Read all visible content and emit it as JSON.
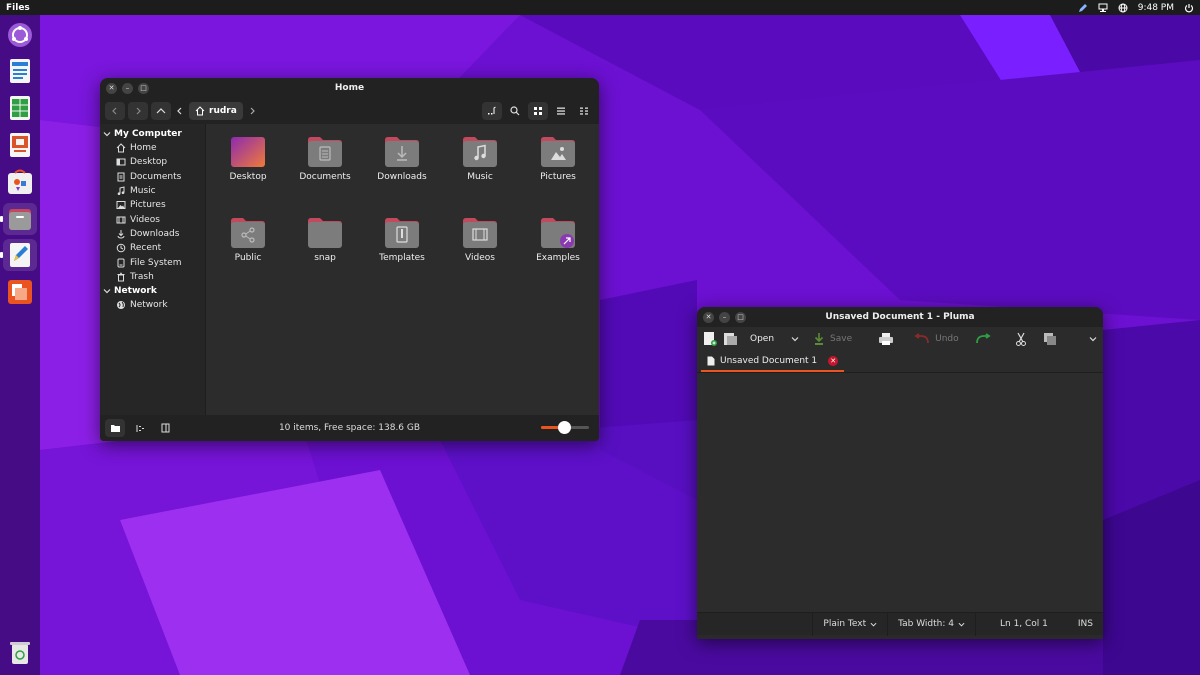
{
  "topbar": {
    "app_name": "Files",
    "time": "9:48 PM",
    "tray_icons": [
      "pen-icon",
      "network-icon",
      "globe-icon",
      "power-icon"
    ]
  },
  "dock": {
    "items": [
      "ubuntu-software-logo-icon",
      "writer-icon",
      "calc-icon",
      "impress-icon",
      "appcenter-icon",
      "files-icon",
      "pluma-icon",
      "ubuntu-help-icon",
      "trash-icon"
    ],
    "active": [
      "files-icon",
      "pluma-icon"
    ]
  },
  "files": {
    "title": "Home",
    "path": "rudra",
    "sidebar": {
      "sections": [
        {
          "header": "My Computer",
          "items": [
            {
              "label": "Home",
              "icon": "home-icon"
            },
            {
              "label": "Desktop",
              "icon": "desktop-icon"
            },
            {
              "label": "Documents",
              "icon": "documents-icon"
            },
            {
              "label": "Music",
              "icon": "music-icon"
            },
            {
              "label": "Pictures",
              "icon": "pictures-icon"
            },
            {
              "label": "Videos",
              "icon": "videos-icon"
            },
            {
              "label": "Downloads",
              "icon": "downloads-icon"
            },
            {
              "label": "Recent",
              "icon": "recent-icon"
            },
            {
              "label": "File System",
              "icon": "drive-icon"
            },
            {
              "label": "Trash",
              "icon": "trash-icon"
            }
          ]
        },
        {
          "header": "Network",
          "items": [
            {
              "label": "Network",
              "icon": "network-globe-icon"
            }
          ]
        }
      ]
    },
    "items": [
      {
        "label": "Desktop",
        "icon": "desktop-folder"
      },
      {
        "label": "Documents",
        "icon": "documents-folder"
      },
      {
        "label": "Downloads",
        "icon": "downloads-folder"
      },
      {
        "label": "Music",
        "icon": "music-folder"
      },
      {
        "label": "Pictures",
        "icon": "pictures-folder"
      },
      {
        "label": "Public",
        "icon": "public-folder"
      },
      {
        "label": "snap",
        "icon": "plain-folder"
      },
      {
        "label": "Templates",
        "icon": "templates-folder"
      },
      {
        "label": "Videos",
        "icon": "videos-folder"
      },
      {
        "label": "Examples",
        "icon": "link-folder"
      }
    ],
    "status": "10 items, Free space: 138.6 GB",
    "zoom_level": 0.48
  },
  "pluma": {
    "title": "Unsaved Document 1 - Pluma",
    "toolbar": {
      "open": "Open",
      "save": "Save",
      "undo": "Undo"
    },
    "tab_label": "Unsaved Document 1",
    "status": {
      "language": "Plain Text",
      "tab_width": "Tab Width:  4",
      "position": "Ln 1, Col 1",
      "mode": "INS"
    }
  },
  "colors": {
    "accent": "#e95420",
    "folder": "#7c7c7c",
    "folder_tab": "#c34a5e",
    "wallpaper_primary": "#6a0fd0"
  }
}
